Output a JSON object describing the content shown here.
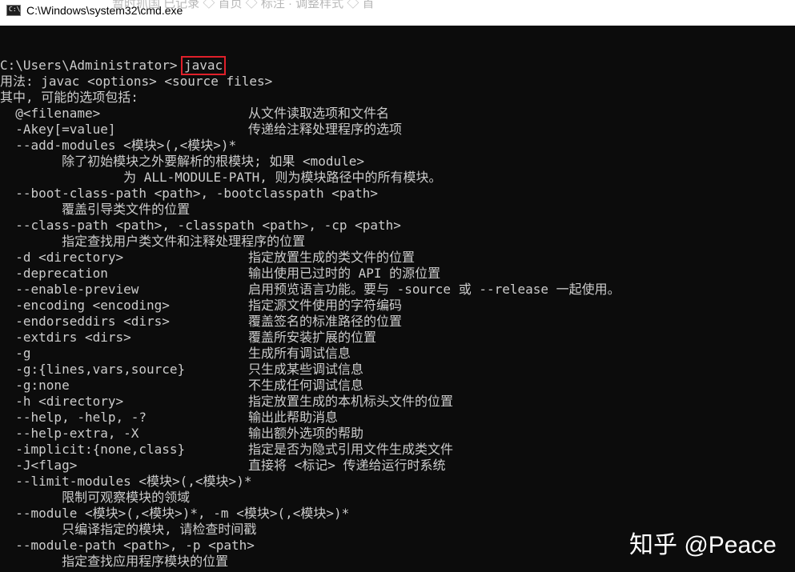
{
  "window": {
    "title": "C:\\Windows\\system32\\cmd.exe",
    "bg_tabs": "  暂时抓国   已记录   ◇ 首页  ◇ 标注 ·  调整样式   ◇ 首"
  },
  "console": {
    "prompt": "C:\\Users\\Administrator>",
    "command": "javac",
    "lines": [
      {
        "a": "用法: javac <options> <source files>"
      },
      {
        "a": "其中, 可能的选项包括:"
      },
      {
        "a": "  @<filename>",
        "b": "从文件读取选项和文件名"
      },
      {
        "a": "  -Akey[=value]",
        "b": "传递给注释处理程序的选项"
      },
      {
        "a": "  --add-modules <模块>(,<模块>)*"
      },
      {
        "a": "        除了初始模块之外要解析的根模块; 如果 <module>"
      },
      {
        "a": "                为 ALL-MODULE-PATH, 则为模块路径中的所有模块。"
      },
      {
        "a": "  --boot-class-path <path>, -bootclasspath <path>"
      },
      {
        "a": "        覆盖引导类文件的位置"
      },
      {
        "a": "  --class-path <path>, -classpath <path>, -cp <path>"
      },
      {
        "a": "        指定查找用户类文件和注释处理程序的位置"
      },
      {
        "a": "  -d <directory>",
        "b": "指定放置生成的类文件的位置"
      },
      {
        "a": "  -deprecation",
        "b": "输出使用已过时的 API 的源位置"
      },
      {
        "a": "  --enable-preview",
        "b": "启用预览语言功能。要与 -source 或 --release 一起使用。"
      },
      {
        "a": "  -encoding <encoding>",
        "b": "指定源文件使用的字符编码"
      },
      {
        "a": "  -endorseddirs <dirs>",
        "b": "覆盖签名的标准路径的位置"
      },
      {
        "a": "  -extdirs <dirs>",
        "b": "覆盖所安装扩展的位置"
      },
      {
        "a": "  -g",
        "b": "生成所有调试信息"
      },
      {
        "a": "  -g:{lines,vars,source}",
        "b": "只生成某些调试信息"
      },
      {
        "a": "  -g:none",
        "b": "不生成任何调试信息"
      },
      {
        "a": "  -h <directory>",
        "b": "指定放置生成的本机标头文件的位置"
      },
      {
        "a": "  --help, -help, -?",
        "b": "输出此帮助消息"
      },
      {
        "a": "  --help-extra, -X",
        "b": "输出额外选项的帮助"
      },
      {
        "a": "  -implicit:{none,class}",
        "b": "指定是否为隐式引用文件生成类文件"
      },
      {
        "a": "  -J<flag>",
        "b": "直接将 <标记> 传递给运行时系统"
      },
      {
        "a": "  --limit-modules <模块>(,<模块>)*"
      },
      {
        "a": "        限制可观察模块的领域"
      },
      {
        "a": "  --module <模块>(,<模块>)*, -m <模块>(,<模块>)*"
      },
      {
        "a": "        只编译指定的模块, 请检查时间戳"
      },
      {
        "a": "  --module-path <path>, -p <path>"
      },
      {
        "a": "        指定查找应用程序模块的位置"
      }
    ]
  },
  "watermark": "知乎 @Peace",
  "colors": {
    "console_bg": "#0c0c0c",
    "console_text": "#cccccc",
    "highlight_box": "#e0202a",
    "titlebar_bg": "#ffffff"
  }
}
